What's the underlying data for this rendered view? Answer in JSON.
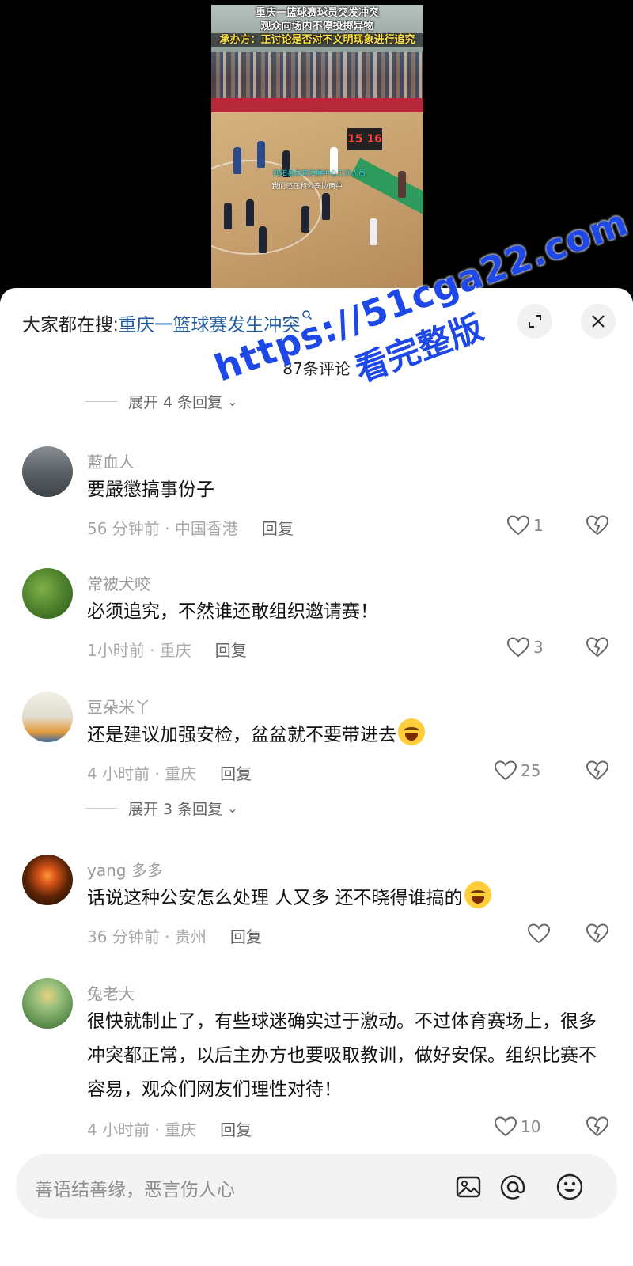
{
  "video": {
    "title_line1": "重庆一篮球赛球员突发冲突",
    "title_line2": "观众向场内不停投掷异物",
    "title_line3": "承办方：正讨论是否对不文明现象进行追究",
    "subtitle1": "西阳县体育发展中心工作人员",
    "subtitle2": "我们还在和公安协商中",
    "scoreboard": "15 16"
  },
  "search": {
    "prefix": "大家都在搜:",
    "query": "重庆一篮球赛发生冲突",
    "mini_icon": "search-icon"
  },
  "header": {
    "count": "87条评论"
  },
  "expand_top": "展开 4 条回复",
  "expand_mid": "展开 3 条回复",
  "comments": [
    {
      "user": "藍血人",
      "text": "要嚴懲搞事份子",
      "time": "56 分钟前 · 中国香港",
      "reply": "回复",
      "likes": "1",
      "avatar_color": "#5b6166"
    },
    {
      "user": "常被犬咬",
      "text": "必须追究，不然谁还敢组织邀请赛！",
      "time": "1小时前 · 重庆",
      "reply": "回复",
      "likes": "3",
      "avatar_color": "#4a7d2a"
    },
    {
      "user": "豆朵米丫",
      "text": "还是建议加强安检，盆盆就不要带进去",
      "time": "4 小时前 · 重庆",
      "reply": "回复",
      "likes": "25",
      "avatar_color": "#e0dccf"
    },
    {
      "user": "yang 多多",
      "text": "话说这种公安怎么处理 人又多 还不晓得谁搞的",
      "time": "36 分钟前 · 贵州",
      "reply": "回复",
      "likes": "",
      "avatar_color": "#2a1408"
    },
    {
      "user": "兔老大",
      "text": "很快就制止了，有些球迷确实过于激动。不过体育赛场上，很多冲突都正常，以后主办方也要吸取教训，做好安保。组织比赛不容易，观众们网友们理性对待！",
      "time": "4 小时前 · 重庆",
      "reply": "回复",
      "likes": "10",
      "avatar_color": "#7aa36a"
    }
  ],
  "input": {
    "placeholder": "善语结善缘，恶言伤人心",
    "icons": [
      "image-icon",
      "at-icon",
      "emoji-icon"
    ]
  },
  "watermark": {
    "line1": "https://51cga22.com",
    "line2": "看完整版"
  },
  "colors": {
    "link": "#1f5a9e",
    "watermark": "#1f48e8",
    "meta": "#a8a8a8"
  }
}
